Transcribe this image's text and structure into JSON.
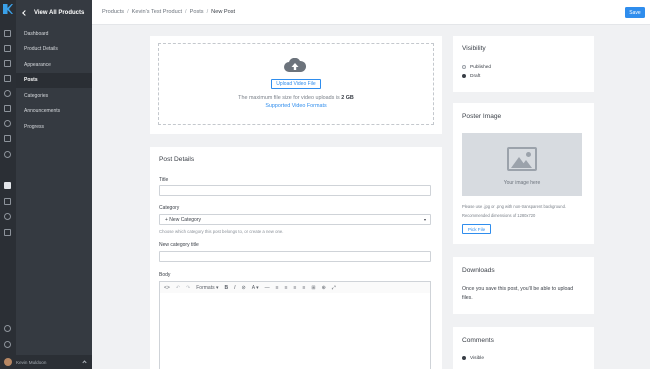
{
  "sidebar": {
    "back_label": "View All Products",
    "items": [
      {
        "label": "Dashboard"
      },
      {
        "label": "Product Details"
      },
      {
        "label": "Appearance"
      },
      {
        "label": "Posts"
      },
      {
        "label": "Categories"
      },
      {
        "label": "Announcements"
      },
      {
        "label": "Progress"
      }
    ],
    "active_item": "Posts",
    "user_name": "Kevin Muldoon"
  },
  "breadcrumb": [
    "Products",
    "Kevin's Test Product",
    "Posts",
    "New Post"
  ],
  "toolbar": {
    "save_label": "Save"
  },
  "upload": {
    "button_label": "Upload Video File",
    "max_size_text": "The maximum file size for video uploads is",
    "max_size_value": "2 GB",
    "formats_link": "Supported Video Formats"
  },
  "post_details": {
    "heading": "Post Details",
    "title_label": "Title",
    "category_label": "Category",
    "category_value": "+ New Category",
    "category_hint": "Choose which category this post belongs to, or create a new one.",
    "new_category_label": "New category title",
    "body_label": "Body",
    "editor_toolbar": [
      "<>",
      "↶",
      "↷",
      "Formats ▾",
      "B",
      "I",
      "⊘",
      "A ▾",
      "—",
      "≡",
      "≡",
      "≡",
      "≡",
      "⊞",
      "⊕",
      "⤢"
    ]
  },
  "visibility": {
    "heading": "Visibility",
    "options": [
      "Published",
      "Draft"
    ],
    "selected": "Draft"
  },
  "poster": {
    "heading": "Poster Image",
    "placeholder_text": "Your image here",
    "hint1": "Please use .jpg or .png with non-transparent background.",
    "hint2": "Recommended dimensions of 1280x720",
    "pick_label": "Pick File"
  },
  "downloads": {
    "heading": "Downloads",
    "text": "Once you save this post, you'll be able to upload files."
  },
  "comments": {
    "heading": "Comments",
    "option": "Visible"
  },
  "colors": {
    "accent": "#2f8ded",
    "sidebar": "#353a41",
    "rail": "#2b2f35"
  }
}
